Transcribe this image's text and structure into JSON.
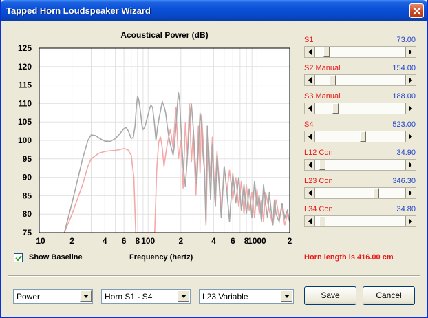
{
  "window": {
    "title": "Tapped Horn Loudspeaker Wizard"
  },
  "chart_data": {
    "type": "line",
    "title": "Acoustical Power (dB)",
    "xlabel": "Frequency (hertz)",
    "x_scale": "log",
    "xlim": [
      10,
      2000
    ],
    "ylim": [
      75,
      125
    ],
    "x_tick_labels": [
      "10",
      "2",
      "4",
      "6",
      "8",
      "100",
      "2",
      "4",
      "6",
      "8",
      "1000",
      "2"
    ],
    "y_ticks": [
      75,
      80,
      85,
      90,
      95,
      100,
      105,
      110,
      115,
      120,
      125
    ],
    "grid": true,
    "series": [
      {
        "color": "#a8a8a8",
        "x": [
          17,
          20,
          25,
          28,
          30,
          33,
          36,
          40,
          45,
          50,
          55,
          60,
          63,
          66,
          70,
          73,
          76,
          78,
          80,
          82,
          85,
          88,
          90,
          93,
          96,
          100,
          103,
          106,
          110,
          114,
          118,
          122,
          126,
          130,
          135,
          140,
          145,
          150,
          155,
          160,
          165,
          170,
          175,
          180,
          185,
          190,
          195,
          200,
          205,
          210,
          220,
          230,
          240,
          250,
          260,
          270,
          280,
          290,
          300,
          310,
          320,
          330,
          340,
          350,
          360,
          375,
          390,
          400,
          415,
          430,
          450,
          470,
          500,
          530,
          560,
          600,
          640,
          680,
          720,
          760,
          800,
          850,
          900,
          950,
          1000,
          1050,
          1100,
          1150,
          1200,
          1250,
          1300,
          1350,
          1400,
          1450,
          1500,
          1600,
          1700,
          1800,
          1900,
          2000
        ],
        "values": [
          75,
          83,
          95,
          100,
          101.5,
          101.3,
          100.5,
          99.8,
          99.7,
          100.5,
          101.8,
          103.2,
          103.5,
          102.5,
          100.5,
          100.8,
          104,
          109,
          112,
          111,
          108,
          104,
          103,
          103.5,
          105,
          107,
          108.5,
          109.5,
          109,
          105,
          100,
          103.5,
          106,
          108,
          110.5,
          109.3,
          107.5,
          104,
          101,
          99,
          97.5,
          96,
          99,
          103.5,
          109,
          113,
          110.5,
          104,
          98,
          93,
          87.5,
          96,
          105,
          110,
          103.5,
          95,
          88,
          98,
          107.5,
          104,
          96,
          92,
          78,
          104,
          98,
          84,
          99,
          91,
          82,
          96,
          88,
          79,
          93,
          86,
          78,
          91,
          83,
          90,
          81,
          88,
          80,
          87,
          79,
          89,
          82,
          85,
          78,
          88,
          83,
          79,
          86,
          81,
          77,
          84,
          80,
          78,
          83,
          79,
          81,
          78
        ]
      },
      {
        "color": "#f5a8a8",
        "x": [
          17,
          20,
          25,
          28,
          30,
          35,
          40,
          45,
          50,
          55,
          60,
          65,
          70,
          74,
          77,
          80,
          82,
          83,
          85,
          87,
          88,
          90,
          92,
          94,
          96,
          98,
          100,
          103,
          106,
          110,
          115,
          120,
          125,
          130,
          135,
          140,
          150,
          160,
          170,
          180,
          190,
          200,
          210,
          220,
          230,
          240,
          250,
          260,
          275,
          290,
          300,
          310,
          325,
          340,
          355,
          370,
          390,
          410,
          430,
          450,
          475,
          500,
          530,
          560,
          600,
          640,
          680,
          720,
          760,
          800,
          850,
          900,
          950,
          1000,
          1050,
          1100,
          1150,
          1200,
          1300,
          1400,
          1500,
          1600,
          1700,
          1800,
          1900,
          2000
        ],
        "values": [
          75,
          80,
          88,
          93,
          95,
          96.5,
          97,
          97.2,
          97.3,
          97.5,
          97.8,
          97.5,
          96,
          90,
          75,
          75,
          75,
          75,
          75,
          75,
          75,
          75,
          75,
          75,
          75,
          75,
          75,
          75,
          75,
          75,
          75,
          92,
          99.5,
          101,
          98,
          93,
          99,
          103,
          98,
          109,
          95,
          100,
          87,
          105,
          96,
          110,
          94,
          102,
          85,
          104,
          91,
          107,
          97,
          77,
          102,
          90,
          101,
          84,
          97,
          89,
          81,
          93,
          86,
          92,
          84,
          90,
          82,
          89,
          80,
          88,
          81,
          86,
          79,
          87,
          80,
          84,
          78,
          86,
          81,
          77,
          84,
          79,
          82,
          77,
          80,
          78
        ]
      }
    ]
  },
  "sliders": [
    {
      "label": "S1",
      "value": "73.00",
      "position": 0.09
    },
    {
      "label": "S2  Manual",
      "value": "154.00",
      "position": 0.17
    },
    {
      "label": "S3  Manual",
      "value": "188.00",
      "position": 0.2
    },
    {
      "label": "S4",
      "value": "523.00",
      "position": 0.53
    },
    {
      "label": "L12  Con",
      "value": "34.90",
      "position": 0.04
    },
    {
      "label": "L23  Con",
      "value": "346.30",
      "position": 0.69
    },
    {
      "label": "L34  Con",
      "value": "34.80",
      "position": 0.04
    }
  ],
  "baseline": {
    "label": "Show Baseline",
    "checked": true
  },
  "horn_length": "Horn length is 416.00 cm",
  "combos": [
    {
      "value": "Power"
    },
    {
      "value": "Horn S1 - S4"
    },
    {
      "value": "L23 Variable"
    }
  ],
  "buttons": {
    "save": "Save",
    "cancel": "Cancel"
  }
}
